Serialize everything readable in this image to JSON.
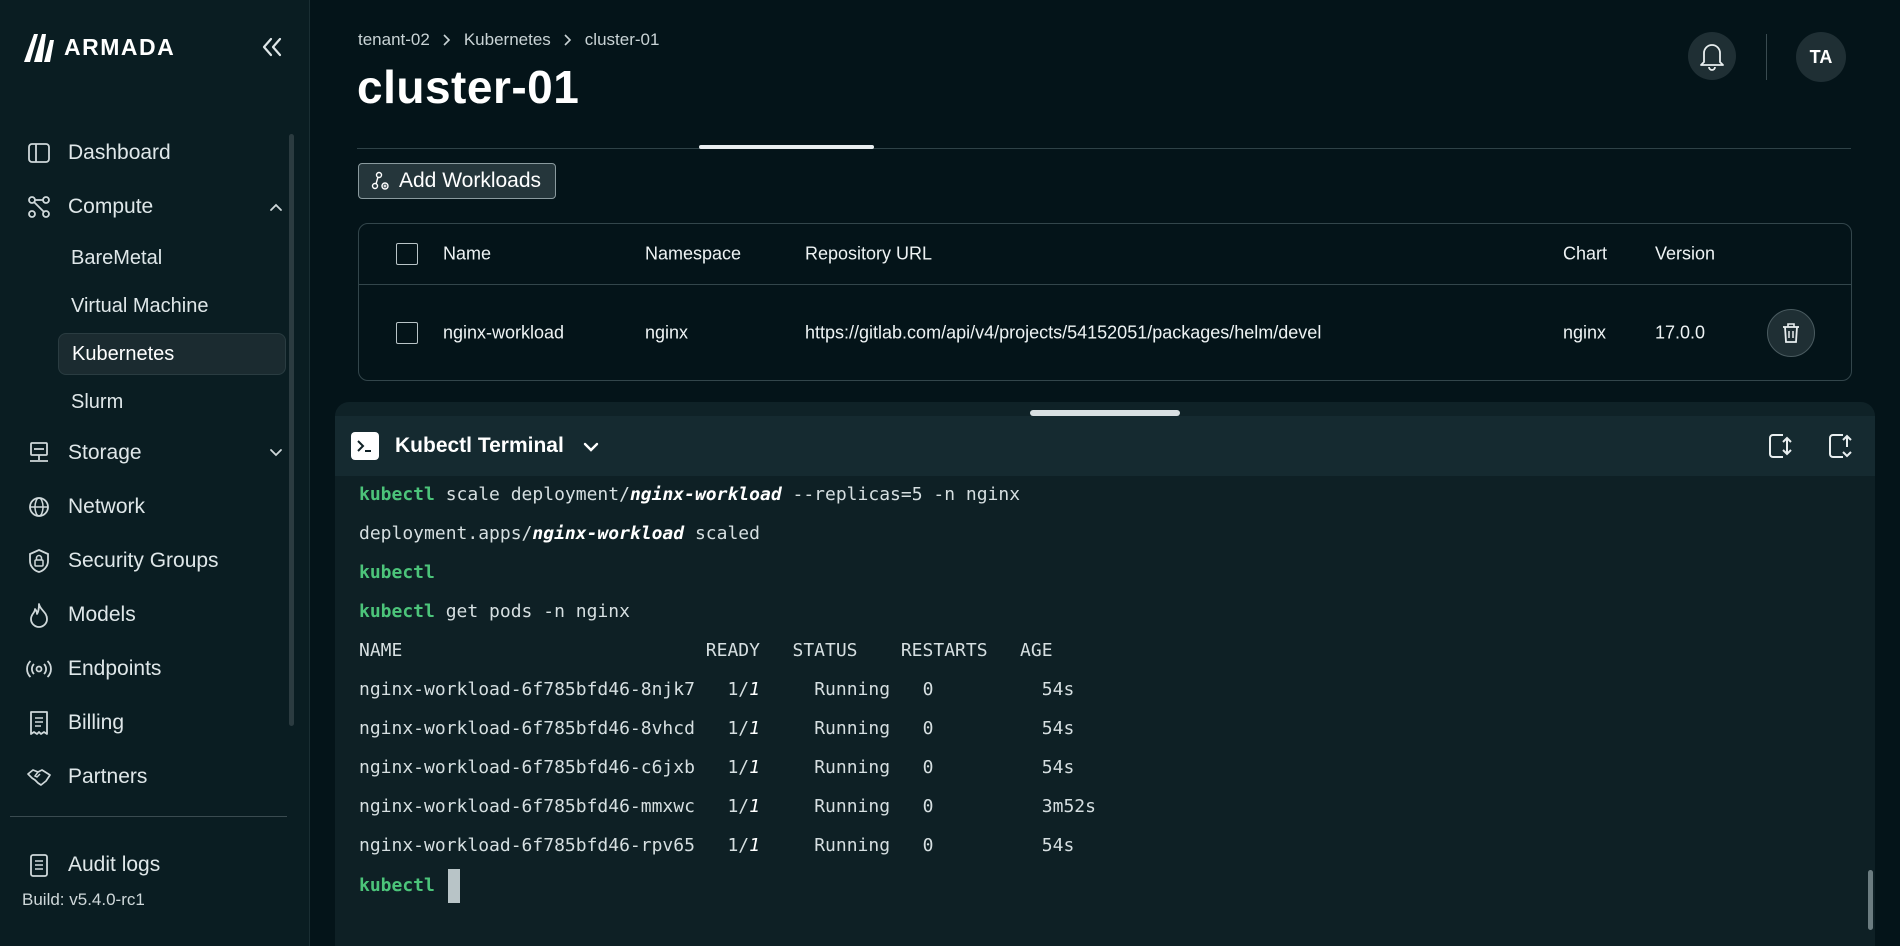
{
  "app": {
    "brand": "ARMADA",
    "build": "Build: v5.4.0-rc1"
  },
  "sidebar": {
    "items": [
      {
        "label": "Dashboard",
        "icon": "dashboard-icon"
      },
      {
        "label": "Compute",
        "icon": "compute-icon",
        "expanded": true,
        "children": [
          "BareMetal",
          "Virtual Machine",
          "Kubernetes",
          "Slurm"
        ],
        "active_child": "Kubernetes"
      },
      {
        "label": "Storage",
        "icon": "storage-icon",
        "expanded": false
      },
      {
        "label": "Network",
        "icon": "globe-icon"
      },
      {
        "label": "Security Groups",
        "icon": "shield-lock-icon"
      },
      {
        "label": "Models",
        "icon": "flame-icon"
      },
      {
        "label": "Endpoints",
        "icon": "broadcast-icon"
      },
      {
        "label": "Billing",
        "icon": "receipt-icon"
      },
      {
        "label": "Partners",
        "icon": "handshake-icon"
      }
    ],
    "audit_logs": "Audit logs"
  },
  "header": {
    "breadcrumb": [
      "tenant-02",
      "Kubernetes",
      "cluster-01"
    ],
    "title": "cluster-01",
    "avatar_initials": "TA"
  },
  "toolbar": {
    "add_workloads": "Add Workloads"
  },
  "table": {
    "columns": [
      "Name",
      "Namespace",
      "Repository URL",
      "Chart",
      "Version"
    ],
    "rows": [
      {
        "name": "nginx-workload",
        "namespace": "nginx",
        "repository_url": "https://gitlab.com/api/v4/projects/54152051/packages/helm/devel",
        "chart": "nginx",
        "version": "17.0.0"
      }
    ]
  },
  "terminal": {
    "title": "Kubectl Terminal",
    "prompt": "kubectl",
    "lines": {
      "cmd1_a": " scale deployment/",
      "cmd1_b": "nginx-workload",
      "cmd1_c": " --replicas=5 -n nginx",
      "out1_a": "deployment.apps/",
      "out1_b": "nginx-workload",
      "out1_c": " scaled",
      "cmd3": " get pods -n nginx",
      "pods_header": "NAME                            READY   STATUS    RESTARTS   AGE",
      "pods": [
        {
          "name": "nginx-workload-6f785bfd46-8njk7",
          "ready_a": "1/",
          "ready_b": "1",
          "status": "Running",
          "restarts": "0",
          "age": "54s"
        },
        {
          "name": "nginx-workload-6f785bfd46-8vhcd",
          "ready_a": "1/",
          "ready_b": "1",
          "status": "Running",
          "restarts": "0",
          "age": "54s"
        },
        {
          "name": "nginx-workload-6f785bfd46-c6jxb",
          "ready_a": "1/",
          "ready_b": "1",
          "status": "Running",
          "restarts": "0",
          "age": "54s"
        },
        {
          "name": "nginx-workload-6f785bfd46-mmxwc",
          "ready_a": "1/",
          "ready_b": "1",
          "status": "Running",
          "restarts": "0",
          "age": "3m52s"
        },
        {
          "name": "nginx-workload-6f785bfd46-rpv65",
          "ready_a": "1/",
          "ready_b": "1",
          "status": "Running",
          "restarts": "0",
          "age": "54s"
        }
      ]
    }
  },
  "colors": {
    "background": "#041419",
    "sidebar": "#0a1d22",
    "prompt_green": "#4cc47a",
    "terminal_bg": "#0e2025"
  }
}
